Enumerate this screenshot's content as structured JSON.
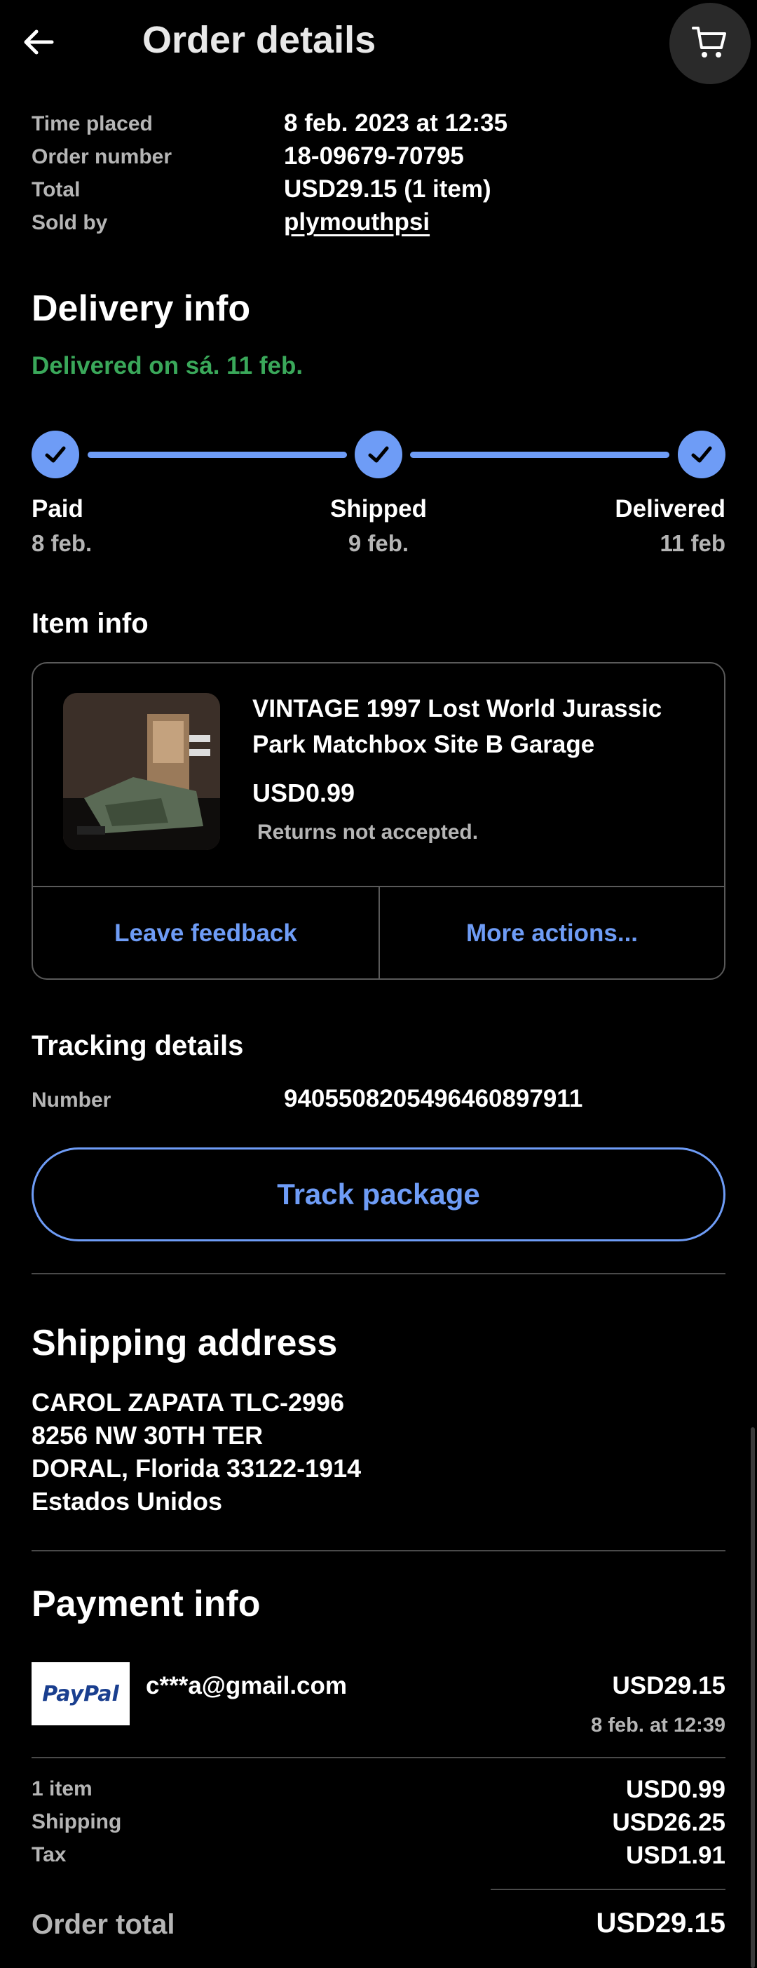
{
  "header": {
    "title": "Order details"
  },
  "meta": {
    "time_placed_label": "Time placed",
    "time_placed_value": "8 feb. 2023 at 12:35",
    "order_number_label": "Order number",
    "order_number_value": "18-09679-70795",
    "total_label": "Total",
    "total_value": "USD29.15 (1 item)",
    "sold_by_label": "Sold by",
    "sold_by_value": "plymouthpsi"
  },
  "delivery": {
    "heading": "Delivery info",
    "status": "Delivered on sá. 11 feb.",
    "status_color": "#3aa85a",
    "steps": [
      {
        "label": "Paid",
        "date": "8 feb."
      },
      {
        "label": "Shipped",
        "date": "9 feb."
      },
      {
        "label": "Delivered",
        "date": "11 feb"
      }
    ],
    "accent_color": "#6e9cf6"
  },
  "item": {
    "heading": "Item info",
    "title": "VINTAGE 1997 Lost World Jurassic Park Matchbox Site B Garage",
    "price": "USD0.99",
    "returns": "Returns not accepted.",
    "leave_feedback": "Leave feedback",
    "more_actions": "More actions..."
  },
  "tracking": {
    "heading": "Tracking details",
    "number_label": "Number",
    "number_value": "9405508205496460897911",
    "track_button": "Track package"
  },
  "shipping": {
    "heading": "Shipping address",
    "lines": [
      "CAROL ZAPATA TLC-2996",
      "8256 NW 30TH TER",
      "DORAL, Florida 33122-1914",
      "Estados Unidos"
    ]
  },
  "payment": {
    "heading": "Payment info",
    "logo_text": "PayPal",
    "email": "c***a@gmail.com",
    "amount": "USD29.15",
    "date": "8 feb. at 12:39",
    "summary": [
      {
        "label": "1 item",
        "value": "USD0.99"
      },
      {
        "label": "Shipping",
        "value": "USD26.25"
      },
      {
        "label": "Tax",
        "value": "USD1.91"
      }
    ],
    "order_total_label": "Order total",
    "order_total_value": "USD29.15"
  }
}
